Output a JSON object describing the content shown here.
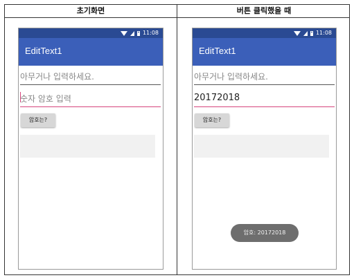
{
  "table": {
    "left_header": "초기화면",
    "right_header": "버튼 클릭했을 때"
  },
  "status_bar": {
    "time": "11:08",
    "icons": [
      "wifi-icon",
      "signal-icon",
      "battery-icon"
    ]
  },
  "app": {
    "title": "EditText1"
  },
  "left_screen": {
    "text_field_placeholder": "아무거나 입력하세요.",
    "password_field_placeholder": "숫자 암호 입력",
    "button_label": "암호는?"
  },
  "right_screen": {
    "text_field_placeholder": "아무거나 입력하세요.",
    "password_field_value": "20172018",
    "button_label": "암호는?",
    "toast": "암호: 20172018"
  },
  "colors": {
    "status_bar": "#2a4a93",
    "toolbar": "#3b5fb9",
    "focus_underline": "#d6447b",
    "toast_bg": "#6e6e6e"
  }
}
